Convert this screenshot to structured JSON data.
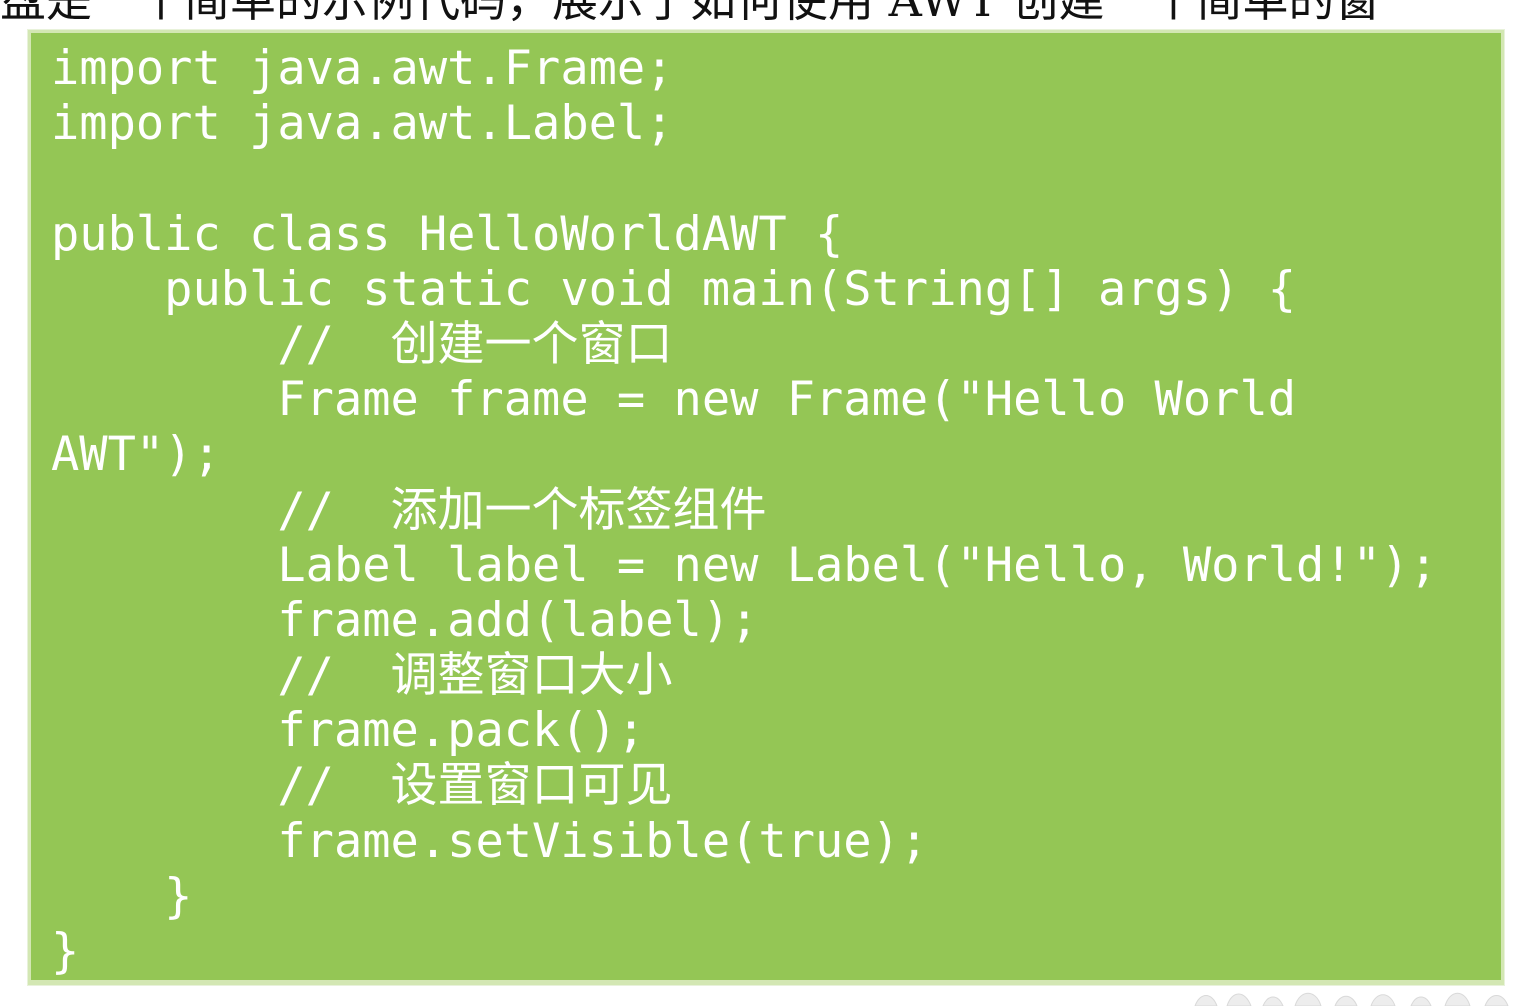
{
  "page": {
    "top_text": "盘是一个简单的示例代码，展示了如何使用 AWT 创建一个简单的窗"
  },
  "code": {
    "lines": [
      "import java.awt.Frame;",
      "import java.awt.Label;",
      "",
      "public class HelloWorldAWT {",
      "    public static void main(String[] args) {",
      "        //  创建一个窗口",
      "        Frame frame = new Frame(\"Hello World",
      "AWT\");",
      "        //  添加一个标签组件",
      "        Label label = new Label(\"Hello, World!\");",
      "        frame.add(label);",
      "        //  调整窗口大小",
      "        frame.pack();",
      "        //  设置窗口可见",
      "        frame.setVisible(true);",
      "    }",
      "}"
    ]
  },
  "colors": {
    "code_background": "#94c655",
    "code_border": "#d3e7b3",
    "code_text": "#ffffff"
  },
  "icons": {
    "decoration": "floral-border-icon"
  }
}
